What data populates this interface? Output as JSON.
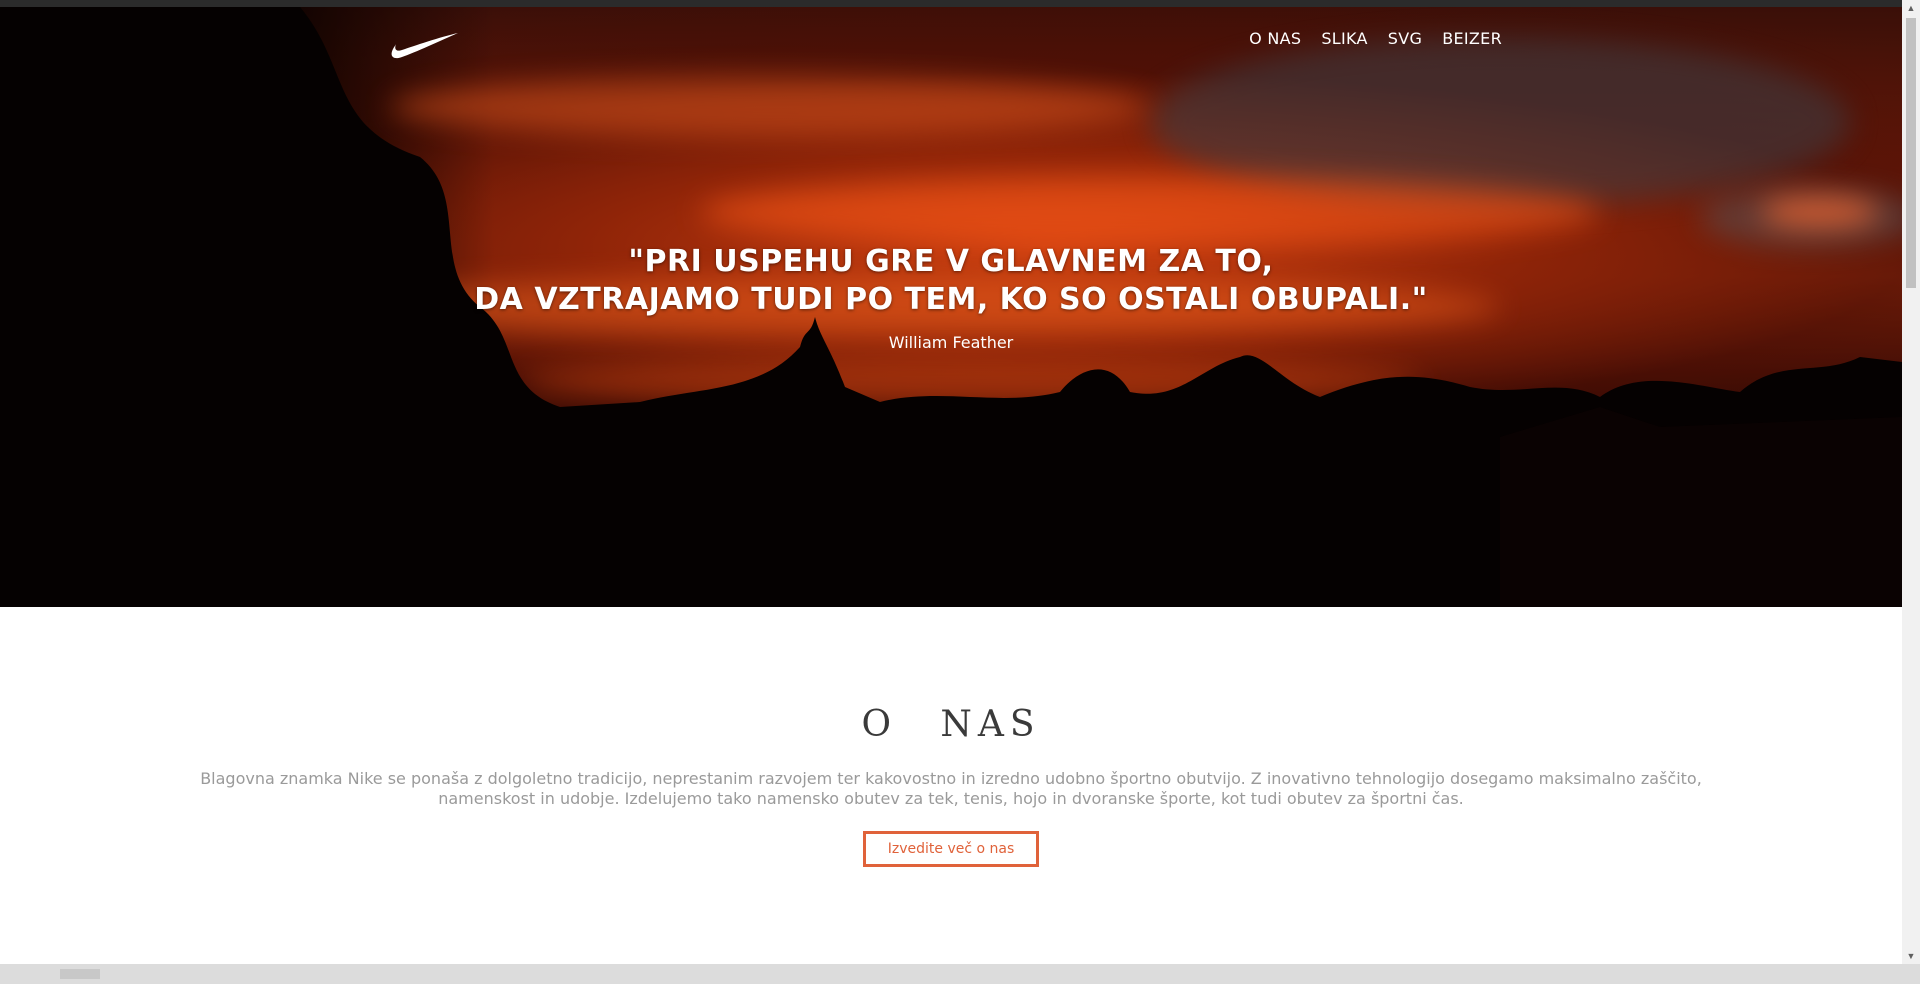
{
  "nav": {
    "items": [
      {
        "label": "O NAS"
      },
      {
        "label": "SLIKA"
      },
      {
        "label": "SVG"
      },
      {
        "label": "BEIZER"
      }
    ]
  },
  "logo": {
    "icon": "nike-swoosh-icon"
  },
  "hero": {
    "quote_line_1": "\"PRI USPEHU GRE V GLAVNEM ZA TO,",
    "quote_line_2": "DA VZTRAJAMO TUDI PO TEM, KO SO OSTALI OBUPALI.\"",
    "author": "William Feather"
  },
  "about": {
    "title": "O NAS",
    "text": "Blagovna znamka Nike se ponaša z dolgoletno tradicijo, neprestanim razvojem ter kakovostno in izredno udobno športno obutvijo. Z inovativno tehnologijo dosegamo maksimalno zaščito, namenskost in udobje. Izdelujemo tako namensko obutev za tek, tenis, hojo in dvoranske športe, kot tudi obutev za športni čas.",
    "button_label": "Izvedite več o nas"
  },
  "colors": {
    "accent": "#e0623a",
    "hero_sky": "#c93e10",
    "text_muted": "#9a9a9a",
    "title": "#3a3a3a"
  }
}
